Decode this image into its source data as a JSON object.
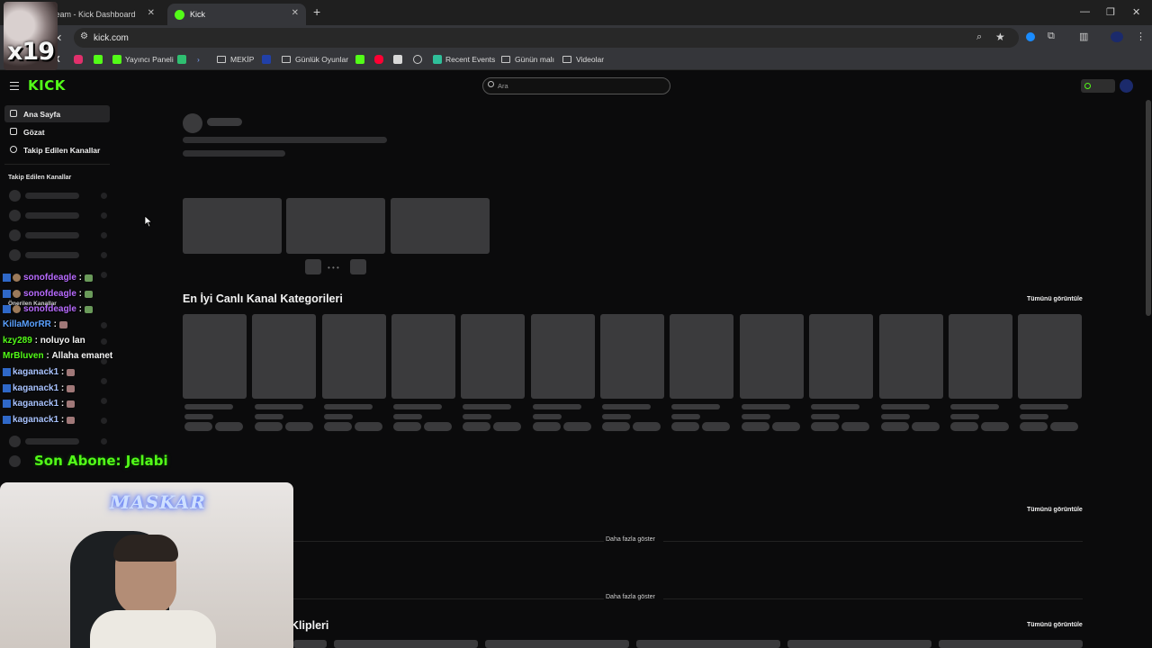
{
  "browser": {
    "tabs": [
      {
        "label": "Stream - Kick Dashboard",
        "active": false
      },
      {
        "label": "Kick",
        "active": true
      }
    ],
    "new_tab": "+",
    "url": "kick.com",
    "bookmarks": [
      {
        "label": "",
        "icon": "x-icon"
      },
      {
        "label": "",
        "icon": "instagram-icon"
      },
      {
        "label": "",
        "icon": "kick-icon"
      },
      {
        "label": "Yayıncı Paneli",
        "icon": "kick-icon"
      },
      {
        "label": "",
        "icon": "green-app-icon"
      },
      {
        "label": "",
        "icon": "arrow-app-icon"
      },
      {
        "label": "MEKİP",
        "icon": "folder-icon"
      },
      {
        "label": "",
        "icon": "blue-app-icon"
      },
      {
        "label": "Günlük Oyunlar",
        "icon": "folder-icon"
      },
      {
        "label": "",
        "icon": "kick-icon"
      },
      {
        "label": "",
        "icon": "youtube-icon"
      },
      {
        "label": "",
        "icon": "image-icon"
      },
      {
        "label": "",
        "icon": "globe-icon"
      },
      {
        "label": "Recent Events",
        "icon": "events-icon"
      },
      {
        "label": "Günün malı",
        "icon": "folder-icon"
      },
      {
        "label": "Videolar",
        "icon": "folder-icon"
      }
    ]
  },
  "kick": {
    "logo": "KICK",
    "search_placeholder": "Ara",
    "nav": [
      {
        "label": "Ana Sayfa",
        "icon": "home-icon"
      },
      {
        "label": "Gözat",
        "icon": "browse-icon"
      },
      {
        "label": "Takip Edilen Kanallar",
        "icon": "heart-icon"
      }
    ],
    "followed_heading": "Takip Edilen Kanallar",
    "recommended_heading": "Önerilen Kanallar"
  },
  "main": {
    "section_categories": "En İyi Canlı Kanal Kategorileri",
    "see_all": "Tümünü görüntüle",
    "show_more": "Daha fazla göster",
    "section_clips": "Klipleri"
  },
  "overlay": {
    "badge": "x19",
    "chat": [
      {
        "user": "sonofdeagle",
        "color": "#b86bff",
        "message": ""
      },
      {
        "user": "sonofdeagle",
        "color": "#b86bff",
        "message": ""
      },
      {
        "user": "sonofdeagle",
        "color": "#b86bff",
        "message": ""
      },
      {
        "user": "KillaMorRR",
        "color": "#5aa0ff",
        "message": ""
      },
      {
        "user": "kzy289",
        "color": "#53fc18",
        "message": "noluyo lan"
      },
      {
        "user": "MrBluven",
        "color": "#53fc18",
        "message": "Allaha emanet"
      },
      {
        "user": "kaganack1",
        "color": "#a9c3ff",
        "message": ""
      },
      {
        "user": "kaganack1",
        "color": "#a9c3ff",
        "message": ""
      },
      {
        "user": "kaganack1",
        "color": "#a9c3ff",
        "message": ""
      },
      {
        "user": "kaganack1",
        "color": "#a9c3ff",
        "message": ""
      }
    ],
    "last_sub": "Son Abone: Jelabi",
    "cam_sign": "MASKAR"
  },
  "colors": {
    "kick_green": "#53fc18",
    "background": "#0b0b0c",
    "skeleton": "#3a3a3c"
  }
}
